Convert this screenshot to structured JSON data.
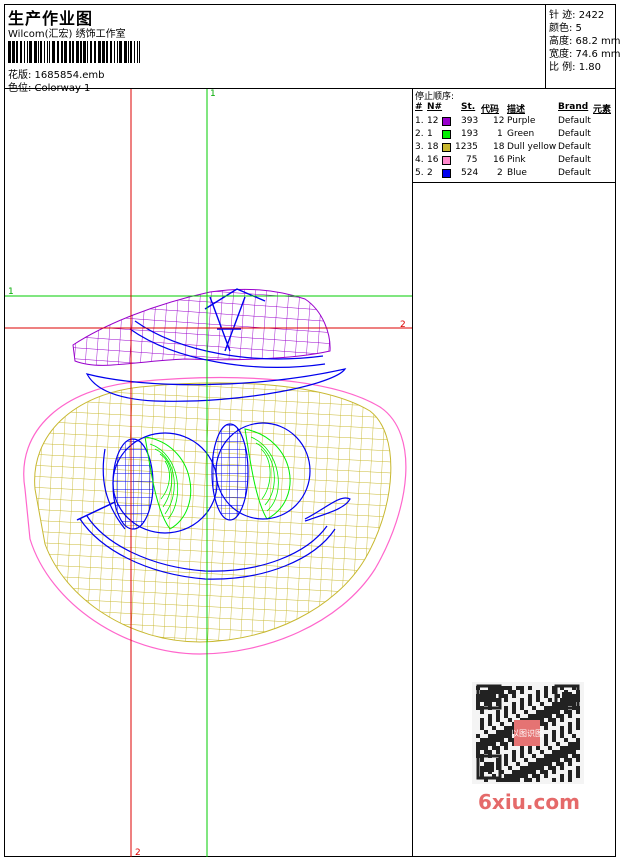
{
  "header": {
    "title": "生产作业图",
    "studio": "Wilcom(汇宏) 绣饰工作室",
    "file_label": "花版: 1685854.emb",
    "colorway_label": "色位: Colorway 1"
  },
  "stats": {
    "stitches": "针 迹: 2422",
    "colors": "颜色: 5",
    "height": "高度: 68.2 mm",
    "width": "宽度: 74.6 mm",
    "scale": "比 例: 1.80"
  },
  "stop_sequence": {
    "title": "停止顺序:",
    "headers": {
      "num": "#",
      "needle": "N#",
      "stitches": "St.",
      "code": "代码",
      "desc": "描述",
      "brand": "Brand",
      "element": "元素"
    },
    "rows": [
      {
        "num": "1.",
        "needle": "12",
        "color": "#9900cc",
        "stitches": "393",
        "code": "12",
        "desc": "Purple",
        "brand": "Default"
      },
      {
        "num": "2.",
        "needle": "1",
        "color": "#00ee00",
        "stitches": "193",
        "code": "1",
        "desc": "Green",
        "brand": "Default"
      },
      {
        "num": "3.",
        "needle": "18",
        "color": "#c8b830",
        "stitches": "1235",
        "code": "18",
        "desc": "Dull yellow",
        "brand": "Default"
      },
      {
        "num": "4.",
        "needle": "16",
        "color": "#ff88cc",
        "stitches": "75",
        "code": "16",
        "desc": "Pink",
        "brand": "Default"
      },
      {
        "num": "5.",
        "needle": "2",
        "color": "#0000ee",
        "stitches": "524",
        "code": "2",
        "desc": "Blue",
        "brand": "Default"
      }
    ]
  },
  "crosshair_labels": {
    "green_top": "1",
    "green_left": "1",
    "red_right": "2",
    "red_bottom": "2"
  },
  "watermark": {
    "text": "6xiu.com",
    "qr_badge": "以图识图"
  }
}
